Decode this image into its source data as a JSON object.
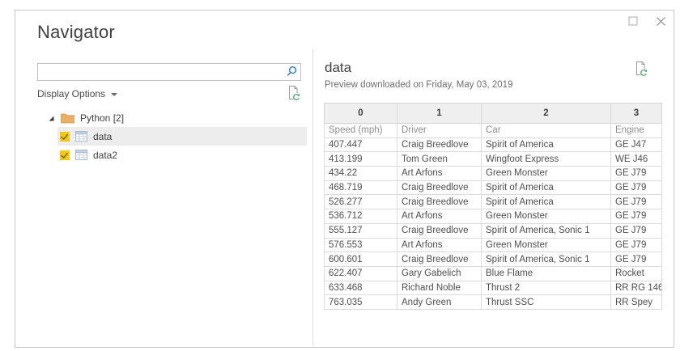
{
  "dialog": {
    "title": "Navigator"
  },
  "window_controls": {
    "maximize_icon": "square-outline",
    "close_icon": "x-cross"
  },
  "search": {
    "value": "",
    "placeholder": "",
    "icon": "magnifier"
  },
  "left_pane": {
    "display_options_label": "Display Options",
    "display_options_icon": "caret-down",
    "refresh_icon": "document-refresh",
    "tree": {
      "group": {
        "label": "Python [2]",
        "expanded": true,
        "icon": "folder"
      },
      "items": [
        {
          "label": "data",
          "checked": true,
          "selected": true,
          "icon": "table-grid"
        },
        {
          "label": "data2",
          "checked": true,
          "selected": false,
          "icon": "table-grid"
        }
      ]
    }
  },
  "preview": {
    "title": "data",
    "subtitle": "Preview downloaded on Friday, May 03, 2019",
    "refresh_icon": "document-refresh",
    "table": {
      "columns": [
        "0",
        "1",
        "2",
        "3"
      ],
      "rows": [
        [
          "Speed (mph)",
          "Driver",
          "Car",
          "Engine"
        ],
        [
          "407.447",
          "Craig Breedlove",
          "Spirit of America",
          "GE J47"
        ],
        [
          "413.199",
          "Tom Green",
          "Wingfoot Express",
          "WE J46"
        ],
        [
          "434.22",
          "Art Arfons",
          "Green Monster",
          "GE J79"
        ],
        [
          "468.719",
          "Craig Breedlove",
          "Spirit of America",
          "GE J79"
        ],
        [
          "526.277",
          "Craig Breedlove",
          "Spirit of America",
          "GE J79"
        ],
        [
          "536.712",
          "Art Arfons",
          "Green Monster",
          "GE J79"
        ],
        [
          "555.127",
          "Craig Breedlove",
          "Spirit of America, Sonic 1",
          "GE J79"
        ],
        [
          "576.553",
          "Art Arfons",
          "Green Monster",
          "GE J79"
        ],
        [
          "600.601",
          "Craig Breedlove",
          "Spirit of America, Sonic 1",
          "GE J79"
        ],
        [
          "622.407",
          "Gary Gabelich",
          "Blue Flame",
          "Rocket"
        ],
        [
          "633.468",
          "Richard Noble",
          "Thrust 2",
          "RR RG 146"
        ],
        [
          "763.035",
          "Andy Green",
          "Thrust SSC",
          "RR Spey"
        ]
      ]
    }
  },
  "colors": {
    "checkbox": "#F2C811",
    "folder": "#EBAE64",
    "refresh_green": "#4FA86C",
    "search_icon": "#3F7EBE"
  }
}
